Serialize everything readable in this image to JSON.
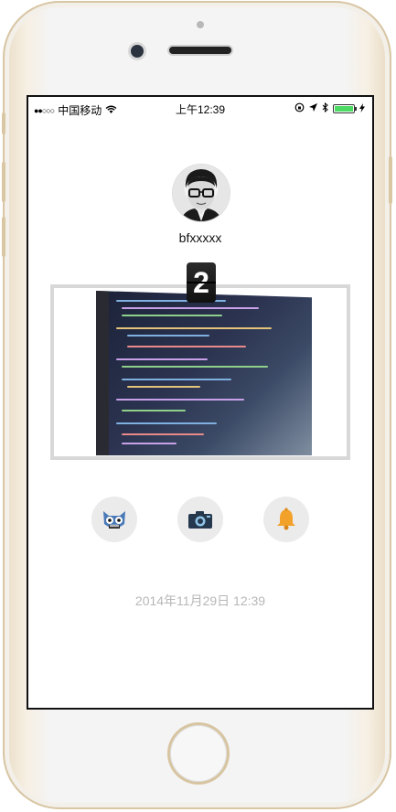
{
  "status_bar": {
    "signal_dots": "●●○○○",
    "carrier": "中国移动",
    "time": "上午12:39",
    "battery_level": 1.0
  },
  "profile": {
    "username": "bfxxxxx"
  },
  "flip_counter": {
    "value": "2"
  },
  "actions": [
    {
      "name": "cat-monster-icon"
    },
    {
      "name": "camera-icon"
    },
    {
      "name": "bell-icon"
    }
  ],
  "timestamp": "2014年11月29日 12:39",
  "colors": {
    "accent_bell": "#f2a12a",
    "camera_body": "#26384e",
    "monster_blue": "#4a79b8",
    "timestamp_gray": "#b7b7b7"
  }
}
